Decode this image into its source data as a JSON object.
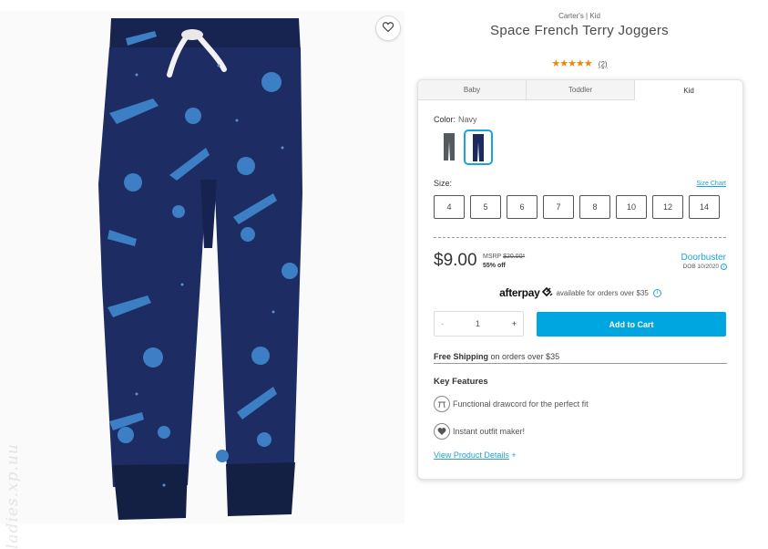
{
  "product": {
    "brand": "Carter's | Kid",
    "title": "Space French Terry Joggers",
    "stars": "★★★★★",
    "review_count": "(2)",
    "rating_value": 5
  },
  "watermark": "ladies.xp.uu",
  "tabs": [
    {
      "label": "Baby"
    },
    {
      "label": "Toddler"
    },
    {
      "label": "Kid",
      "active": true
    }
  ],
  "color": {
    "label": "Color:",
    "value": "Navy",
    "swatches": [
      "gray",
      "navy"
    ]
  },
  "size": {
    "label": "Size:",
    "chart_link": "Size Chart",
    "options": [
      "4",
      "5",
      "6",
      "7",
      "8",
      "10",
      "12",
      "14"
    ]
  },
  "pricing": {
    "price": "$9.00",
    "msrp_label": "MSRP",
    "msrp_value": "$20.00*",
    "discount": "55% off",
    "deal": "Doorbuster",
    "dob": "DOB 10/2020"
  },
  "afterpay": {
    "logo": "afterpay",
    "text": "available for orders over $35"
  },
  "quantity": {
    "minus": "-",
    "value": "1",
    "plus": "+"
  },
  "cart": {
    "add_label": "Add to Cart"
  },
  "shipping": {
    "bold": "Free Shipping",
    "rest": "on orders over $35"
  },
  "features": {
    "title": "Key Features",
    "items": [
      {
        "text": "Functional drawcord for the perfect fit",
        "icon": "drawcord-icon"
      },
      {
        "text": "Instant outfit maker!",
        "icon": "outfit-maker-icon"
      }
    ]
  },
  "details_link": {
    "label": "View Product Details",
    "plus": "+"
  },
  "colors": {
    "accent": "#00a6e0",
    "star": "#e8890c",
    "navy": "#1b2a5c",
    "print": "#3d7fc4"
  }
}
